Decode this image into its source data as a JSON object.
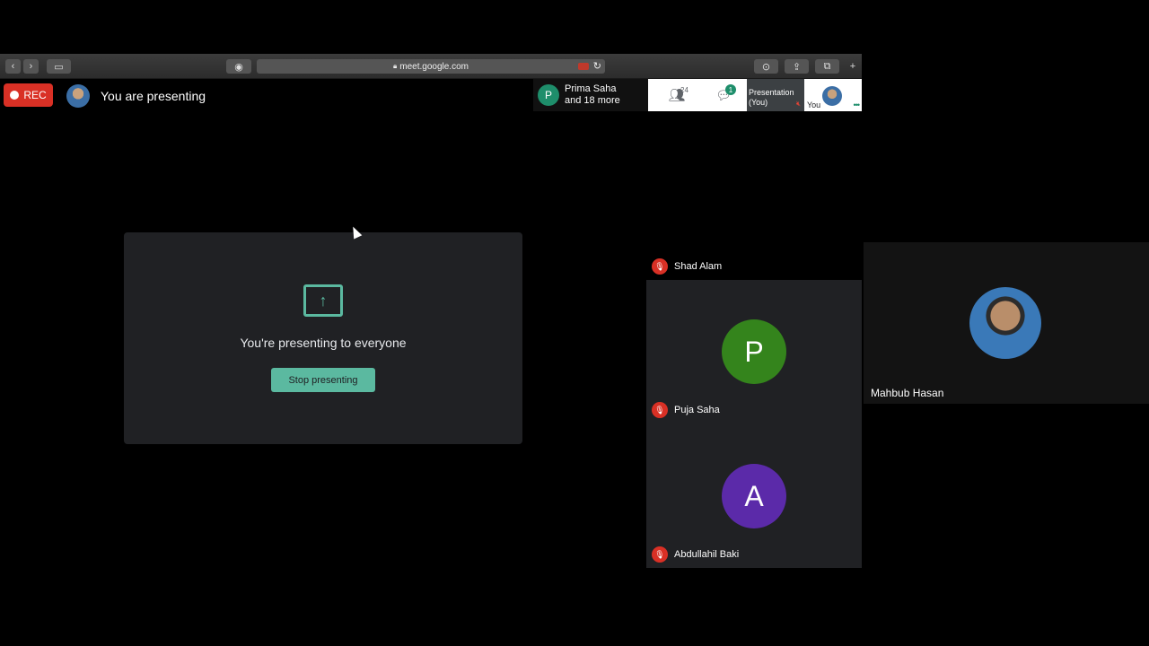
{
  "browser": {
    "url": "meet.google.com"
  },
  "header": {
    "rec_label": "REC",
    "presenting_status": "You are presenting"
  },
  "participants_chip": {
    "initial": "P",
    "line1": "Prima Saha",
    "line2": "and 18 more"
  },
  "right_toolbar": {
    "people_count": "24",
    "chat_badge": "1",
    "presentation_label_line1": "Presentation",
    "presentation_label_line2": "(You)",
    "you_label": "You"
  },
  "present_card": {
    "title": "You're presenting to everyone",
    "stop_button": "Stop presenting"
  },
  "tiles": [
    {
      "name": "Shad Alam",
      "muted": true
    },
    {
      "name": "Puja Saha",
      "initial": "P",
      "avatar_color": "#34841c",
      "muted": true
    },
    {
      "name": "Abdullahil Baki",
      "initial": "A",
      "avatar_color": "#5b2aa9",
      "muted": true
    }
  ],
  "side_tile": {
    "name": "Mahbub Hasan"
  },
  "colors": {
    "accent": "#5bb9a0",
    "rec": "#d93025"
  }
}
